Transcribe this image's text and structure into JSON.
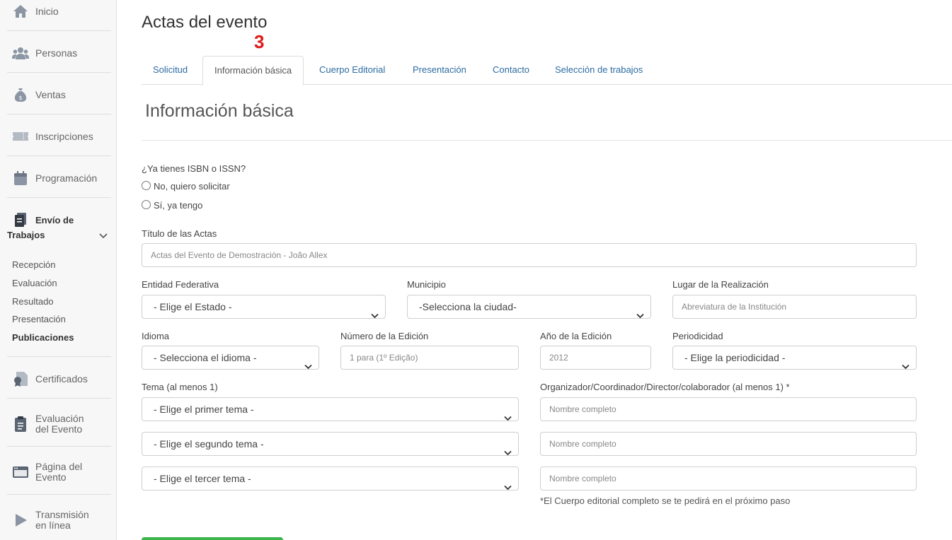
{
  "sidebar": {
    "items": [
      {
        "label": "Inicio",
        "icon": "home-icon"
      },
      {
        "label": "Personas",
        "icon": "people-icon"
      },
      {
        "label": "Ventas",
        "icon": "money-bag-icon"
      },
      {
        "label": "Inscripciones",
        "icon": "ticket-icon"
      },
      {
        "label": "Programación",
        "icon": "calendar-icon"
      }
    ],
    "envio": {
      "line1": "Envío de",
      "line2": "Trabajos",
      "icon": "document-icon"
    },
    "sub_items": [
      "Recepción",
      "Evaluación",
      "Resultado",
      "Presentación",
      "Publicaciones"
    ],
    "lower_items": [
      {
        "line1": "Certificados",
        "line2": "",
        "icon": "certificate-icon"
      },
      {
        "line1": "Evaluación",
        "line2": "del Evento",
        "icon": "clipboard-icon"
      },
      {
        "line1": "Página del",
        "line2": "Evento",
        "icon": "browser-window-icon"
      },
      {
        "line1": "Transmisión",
        "line2": "en línea",
        "icon": "play-icon"
      }
    ]
  },
  "page": {
    "title": "Actas del evento",
    "step_badge": "3"
  },
  "tabs": [
    "Solicitud",
    "Información básica",
    "Cuerpo Editorial",
    "Presentación",
    "Contacto",
    "Selección de trabajos"
  ],
  "section_title": "Información básica",
  "form": {
    "isbn_question": "¿Ya tienes ISBN o ISSN?",
    "radio_no": "No, quiero solicitar",
    "radio_yes": "Sí, ya tengo",
    "titulo_label": "Título de las Actas",
    "titulo_value": "Actas del Evento de Demostración - João Allex",
    "entidad_label": "Entidad Federativa",
    "entidad_value": "- Elige el Estado -",
    "municipio_label": "Municipio",
    "municipio_value": "-Selecciona la ciudad-",
    "lugar_label": "Lugar de la Realización",
    "lugar_placeholder": "Abreviatura de la Institución",
    "idioma_label": "Idioma",
    "idioma_value": "- Selecciona el idioma -",
    "edicion_label": "Número de la Edición",
    "edicion_placeholder": "1 para (1º Edição)",
    "anio_label": "Año de la Edición",
    "anio_placeholder": "2012",
    "periodicidad_label": "Periodicidad",
    "periodicidad_value": "- Elige la periodicidad -",
    "tema_label": "Tema (al menos 1)",
    "tema1_value": "- Elige el primer tema -",
    "tema2_value": "- Elige el segundo tema -",
    "tema3_value": "- Elige el tercer tema -",
    "organizador_label": "Organizador/Coordinador/Director/colaborador (al menos 1) *",
    "nombre_placeholder": "Nombre completo",
    "note": "*El Cuerpo editorial completo se te pedirá en el próximo paso"
  },
  "colors": {
    "link": "#2d6ca2",
    "badge": "#e01818",
    "button": "#3cb54a",
    "sidebar_icon": "#8b95a3"
  }
}
